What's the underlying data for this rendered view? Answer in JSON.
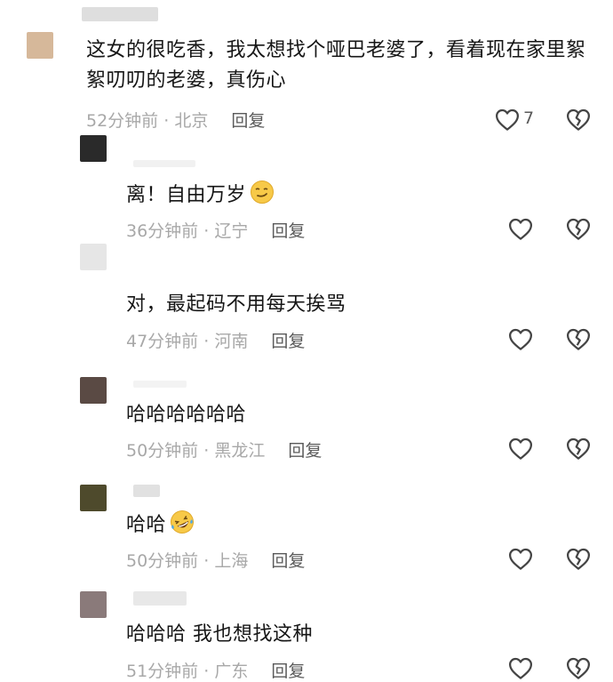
{
  "comments": [
    {
      "text": "这女的很吃香，我太想找个哑巴老婆了，看着现在家里絮絮叨叨的老婆，真伤心",
      "time": "52分钟前",
      "location": "北京",
      "reply": "回复",
      "likes": "7",
      "avatar_color": "#d6b89a"
    },
    {
      "text": "离！自由万岁",
      "emoji": "smirk-emoji",
      "time": "36分钟前",
      "location": "辽宁",
      "reply": "回复",
      "avatar_color": "#2a2a2a"
    },
    {
      "text": "对，最起码不用每天挨骂",
      "time": "47分钟前",
      "location": "河南",
      "reply": "回复",
      "avatar_color": "#e6e6e6"
    },
    {
      "text": "哈哈哈哈哈哈",
      "time": "50分钟前",
      "location": "黑龙江",
      "reply": "回复",
      "avatar_color": "#5a4a44"
    },
    {
      "text": "哈哈",
      "emoji": "rofl-emoji",
      "time": "50分钟前",
      "location": "上海",
      "reply": "回复",
      "avatar_color": "#4e4a2c"
    },
    {
      "text": "哈哈哈 我也想找这种",
      "time": "51分钟前",
      "location": "广东",
      "reply": "回复",
      "avatar_color": "#8a7a7a"
    }
  ]
}
